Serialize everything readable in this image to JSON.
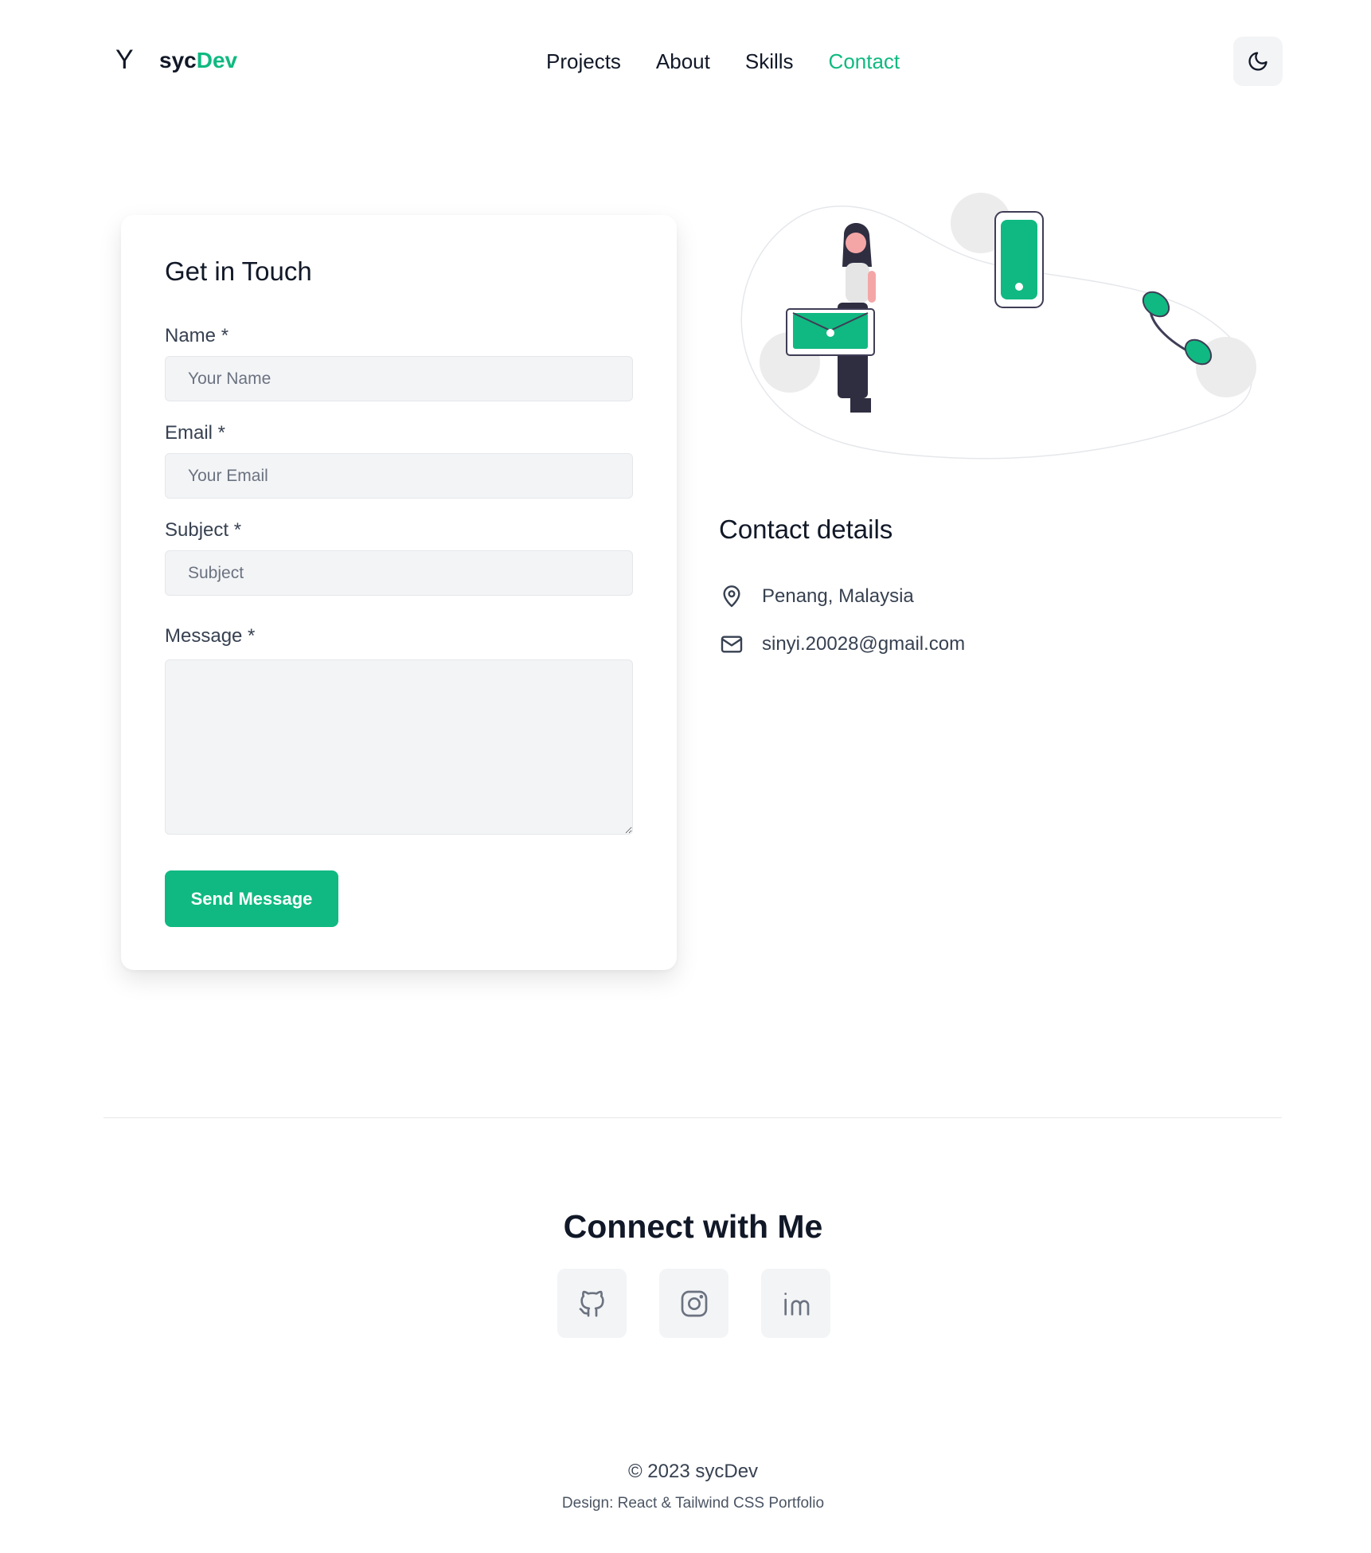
{
  "header": {
    "logo_mark": "Y",
    "logo_text_a": "syc",
    "logo_text_b": "Dev",
    "nav": [
      "Projects",
      "About",
      "Skills",
      "Contact"
    ],
    "active_nav": "Contact",
    "theme_toggle_icon": "moon-icon"
  },
  "form": {
    "title": "Get in Touch",
    "name_label": "Name *",
    "name_placeholder": "Your Name",
    "email_label": "Email *",
    "email_placeholder": "Your Email",
    "subject_label": "Subject *",
    "subject_placeholder": "Subject",
    "message_label": "Message *",
    "submit_label": "Send Message"
  },
  "contact_details": {
    "title": "Contact details",
    "location_icon": "map-pin-icon",
    "location": "Penang, Malaysia",
    "email_icon": "mail-icon",
    "email": "sinyi.20028@gmail.com"
  },
  "connect": {
    "title": "Connect with Me",
    "socials": [
      "github-icon",
      "instagram-icon",
      "linkedin-icon"
    ]
  },
  "footer": {
    "copyright": "© 2023 sycDev",
    "design": "Design: React & Tailwind CSS Portfolio"
  },
  "colors": {
    "accent": "#10b981",
    "text": "#111827",
    "muted": "#374151",
    "input_bg": "#f3f4f6"
  }
}
